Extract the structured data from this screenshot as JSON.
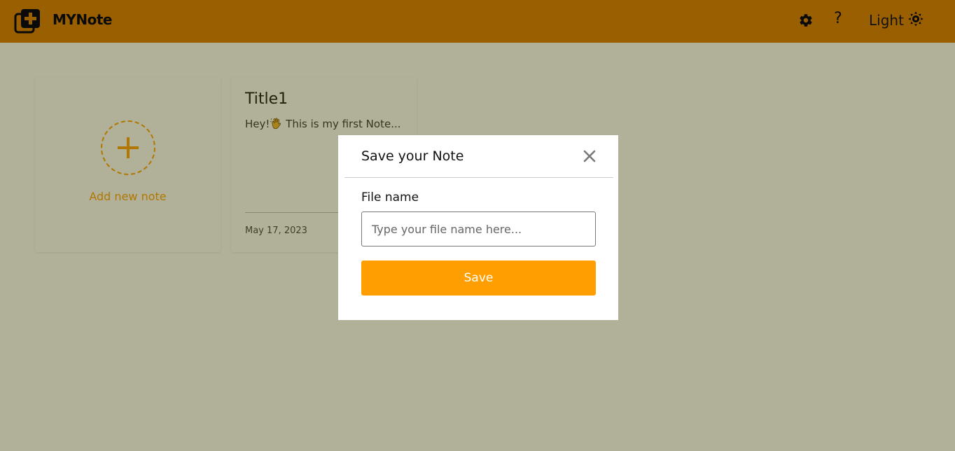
{
  "app": {
    "title": "MYNote",
    "theme_label": "Light"
  },
  "colors": {
    "accent": "#FF9E00",
    "header_bg": "#9A5B00",
    "backdrop": "#9B9955",
    "card_bg": "#9B9B9B"
  },
  "icons": {
    "logo": "notes-plus-icon",
    "settings": "gear-icon",
    "help": "question-icon",
    "theme": "sun-icon",
    "close": "close-icon",
    "add": "plus-icon",
    "emoji": "waving-hand-icon"
  },
  "header": {
    "help_glyph": "?"
  },
  "notes": {
    "add_label": "Add new note",
    "items": [
      {
        "title": "Title1",
        "preview_prefix": "Hey!",
        "preview_suffix": " This is my first Note...",
        "date": "May 17, 2023"
      }
    ]
  },
  "modal": {
    "title": "Save your Note",
    "field_label": "File name",
    "input_placeholder": "Type your file name here...",
    "input_value": "",
    "save_label": "Save"
  }
}
